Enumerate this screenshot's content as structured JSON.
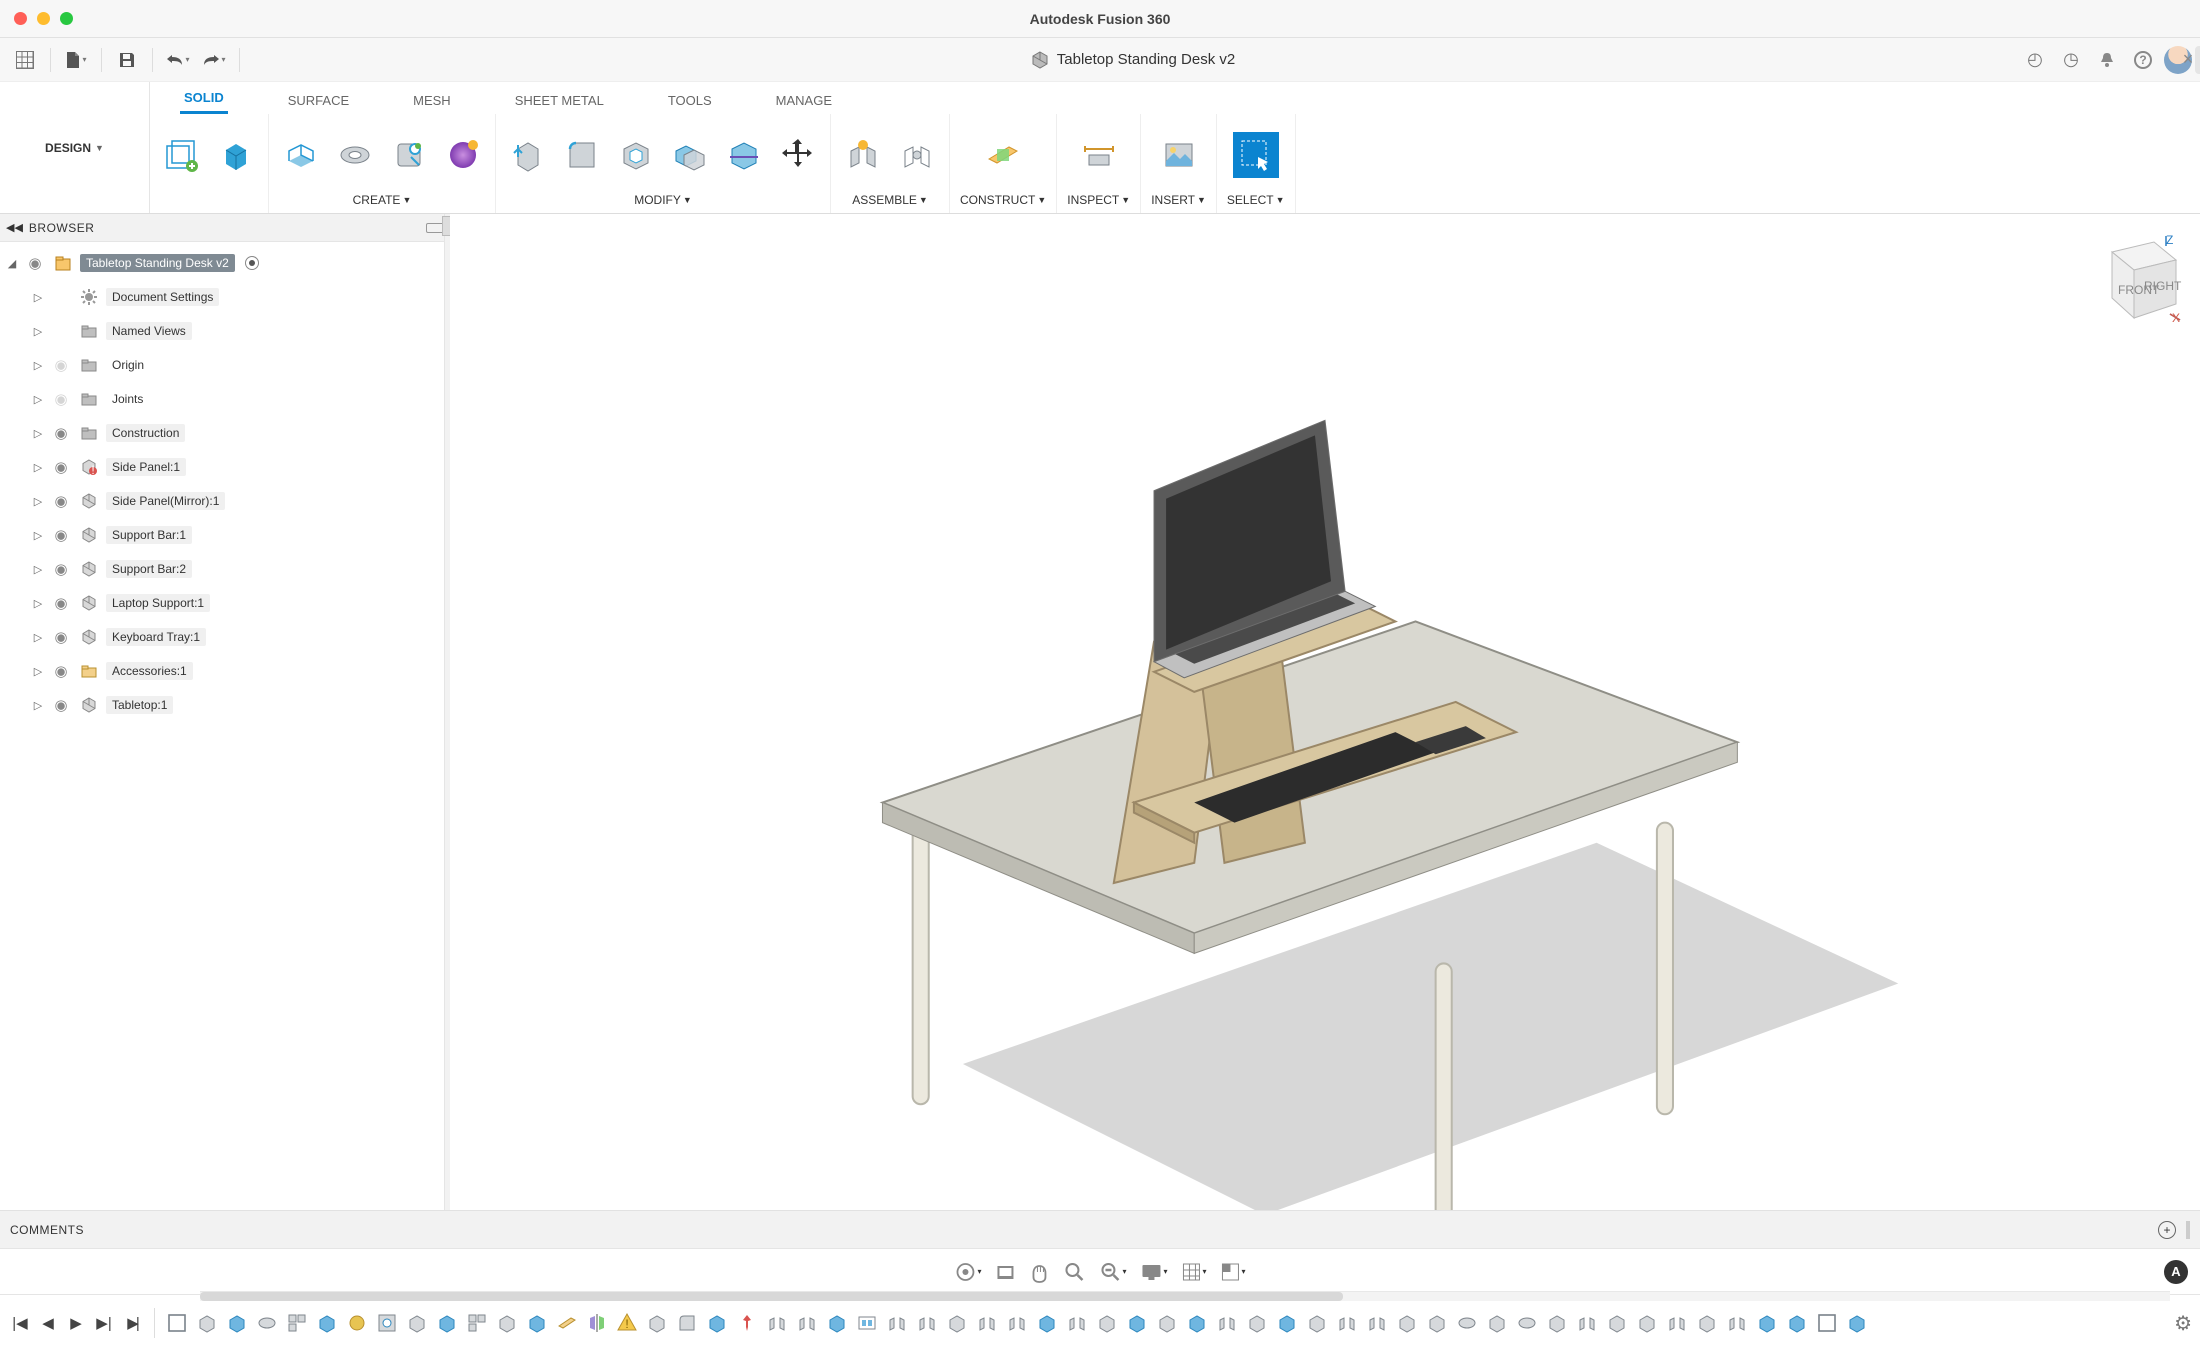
{
  "app": {
    "title": "Autodesk Fusion 360"
  },
  "qat": {
    "icons": [
      "grid-icon",
      "file-icon",
      "save-icon",
      "undo-icon",
      "redo-icon"
    ]
  },
  "document": {
    "icon": "cube-icon",
    "title": "Tabletop Standing Desk v2"
  },
  "topright": {
    "icons": [
      "extensions-icon",
      "job-status-icon",
      "notifications-icon",
      "help-icon",
      "profile-icon"
    ]
  },
  "workspace": {
    "label": "DESIGN"
  },
  "ribbon": {
    "tabs": [
      "SOLID",
      "SURFACE",
      "MESH",
      "SHEET METAL",
      "TOOLS",
      "MANAGE"
    ],
    "active": 0,
    "groups": [
      {
        "label": "",
        "icons": [
          "sketch-icon",
          "box-icon"
        ]
      },
      {
        "label": "CREATE",
        "dropdown": true,
        "icons": [
          "extrude-icon",
          "revolve-icon",
          "hole-icon",
          "form-icon"
        ]
      },
      {
        "label": "MODIFY",
        "dropdown": true,
        "icons": [
          "presspull-icon",
          "fillet-icon",
          "shell-icon",
          "combine-icon",
          "split-icon",
          "move-icon"
        ]
      },
      {
        "label": "ASSEMBLE",
        "dropdown": true,
        "icons": [
          "joint-icon",
          "as-built-joint-icon"
        ]
      },
      {
        "label": "CONSTRUCT",
        "dropdown": true,
        "icons": [
          "plane-icon"
        ]
      },
      {
        "label": "INSPECT",
        "dropdown": true,
        "icons": [
          "measure-icon"
        ]
      },
      {
        "label": "INSERT",
        "dropdown": true,
        "icons": [
          "decal-icon"
        ]
      },
      {
        "label": "SELECT",
        "dropdown": true,
        "icons": [
          "select-icon"
        ],
        "active": true
      }
    ]
  },
  "browser": {
    "title": "BROWSER",
    "root": "Tabletop Standing Desk v2",
    "nodes": [
      {
        "label": "Document Settings",
        "icon": "gear",
        "eye": false,
        "shade": true
      },
      {
        "label": "Named Views",
        "icon": "folder",
        "eye": false,
        "shade": true
      },
      {
        "label": "Origin",
        "icon": "folder",
        "eye": "dim",
        "shade": false
      },
      {
        "label": "Joints",
        "icon": "folder",
        "eye": "dim",
        "shade": false
      },
      {
        "label": "Construction",
        "icon": "folder",
        "eye": true,
        "shade": true
      },
      {
        "label": "Side Panel:1",
        "icon": "comp-warn",
        "eye": true,
        "shade": true
      },
      {
        "label": "Side Panel(Mirror):1",
        "icon": "comp",
        "eye": true,
        "shade": true
      },
      {
        "label": "Support Bar:1",
        "icon": "comp",
        "eye": true,
        "shade": true
      },
      {
        "label": "Support Bar:2",
        "icon": "comp",
        "eye": true,
        "shade": true
      },
      {
        "label": "Laptop Support:1",
        "icon": "comp",
        "eye": true,
        "shade": true
      },
      {
        "label": "Keyboard Tray:1",
        "icon": "comp",
        "eye": true,
        "shade": true
      },
      {
        "label": "Accessories:1",
        "icon": "assy",
        "eye": true,
        "shade": true
      },
      {
        "label": "Tabletop:1",
        "icon": "comp",
        "eye": true,
        "shade": true
      }
    ]
  },
  "viewcube": {
    "front": "FRONT",
    "right": "RIGHT",
    "z": "Z",
    "x": "X"
  },
  "comments": {
    "title": "COMMENTS"
  },
  "navbar": {
    "icons": [
      "orbit-icon",
      "look-at-icon",
      "pan-icon",
      "zoom-fit-icon",
      "zoom-icon",
      "display-icon",
      "grid-settings-icon",
      "viewport-icon"
    ]
  },
  "timeline": {
    "play_icons": [
      "first-icon",
      "prev-icon",
      "play-icon",
      "next-icon",
      "last-icon"
    ]
  }
}
